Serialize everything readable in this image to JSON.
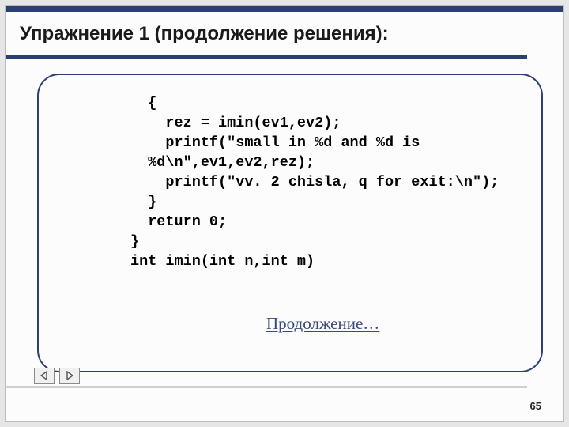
{
  "header": {
    "title": "Упражнение 1 (продолжение решения):"
  },
  "code": {
    "lines": "  {\n    rez = imin(ev1,ev2);\n    printf(\"small in %d and %d is\n  %d\\n\",ev1,ev2,rez);\n    printf(\"vv. 2 chisla, q for exit:\\n\");\n  }\n  return 0;\n}\nint imin(int n,int m)"
  },
  "link": {
    "continue_label": "Продолжение…"
  },
  "nav": {
    "prev_icon": "triangle-left",
    "next_icon": "triangle-right"
  },
  "footer": {
    "page_number": "65"
  }
}
